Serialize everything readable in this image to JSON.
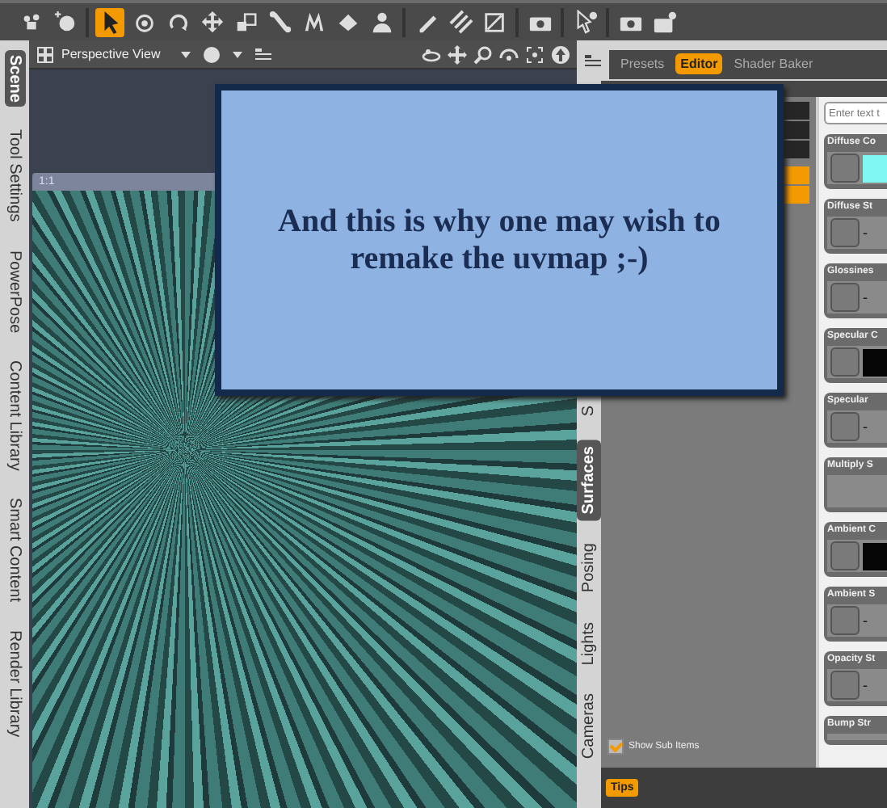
{
  "toolbar": {
    "tool_groups": [
      [
        {
          "selected": false
        },
        {
          "selected": false
        }
      ],
      [
        {
          "selected": true
        },
        {
          "selected": false
        },
        {
          "selected": false
        },
        {
          "selected": false
        },
        {
          "selected": false
        },
        {
          "selected": false
        },
        {
          "selected": false
        },
        {
          "selected": false
        },
        {
          "selected": false
        }
      ],
      [
        {
          "selected": false
        },
        {
          "selected": false
        },
        {
          "selected": false
        }
      ],
      [
        {
          "selected": false
        }
      ],
      [
        {
          "selected": false
        }
      ],
      [
        {
          "selected": false
        },
        {
          "selected": false
        }
      ]
    ]
  },
  "left_tabs": [
    {
      "label": "Scene",
      "selected": true
    },
    {
      "label": "Tool Settings",
      "selected": false
    },
    {
      "label": "PowerPose",
      "selected": false
    },
    {
      "label": "Content Library",
      "selected": false
    },
    {
      "label": "Smart Content",
      "selected": false
    },
    {
      "label": "Render Library",
      "selected": false
    }
  ],
  "viewport": {
    "camera": "Perspective View",
    "frame_label": "1:1"
  },
  "message": "And this is why one may wish to remake the uvmap ;-)",
  "right_tabs": [
    {
      "label": "S",
      "selected": false
    },
    {
      "label": "Surfaces",
      "selected": true
    },
    {
      "label": "Posing",
      "selected": false
    },
    {
      "label": "Lights",
      "selected": false
    },
    {
      "label": "Cameras",
      "selected": false
    }
  ],
  "surfaces_pane": {
    "tabs": [
      {
        "label": "Presets",
        "selected": false
      },
      {
        "label": "Editor",
        "selected": true
      },
      {
        "label": "Shader Baker",
        "selected": false
      }
    ],
    "tree_rows": [
      {
        "selected": false
      },
      {
        "selected": false
      },
      {
        "selected": false
      },
      {
        "selected": true
      },
      {
        "selected": true
      }
    ],
    "show_sub_items": {
      "label": "Show Sub Items",
      "checked": true
    },
    "search": {
      "placeholder": "Enter text t"
    },
    "properties": [
      {
        "label": "Diffuse Co",
        "kind": "color",
        "color": "#7ff7f0"
      },
      {
        "label": "Diffuse St",
        "kind": "value",
        "value": "-"
      },
      {
        "label": "Glossines",
        "kind": "value",
        "value": "-"
      },
      {
        "label": "Specular C",
        "kind": "color",
        "color": "#050505"
      },
      {
        "label": "Specular",
        "kind": "value",
        "value": "-"
      },
      {
        "label": "Multiply S",
        "kind": "empty"
      },
      {
        "label": "Ambient C",
        "kind": "color",
        "color": "#050505"
      },
      {
        "label": "Ambient S",
        "kind": "value",
        "value": "-"
      },
      {
        "label": "Opacity St",
        "kind": "value",
        "value": "-"
      },
      {
        "label": "Bump Str",
        "kind": "partial"
      }
    ],
    "tips": "Tips"
  }
}
